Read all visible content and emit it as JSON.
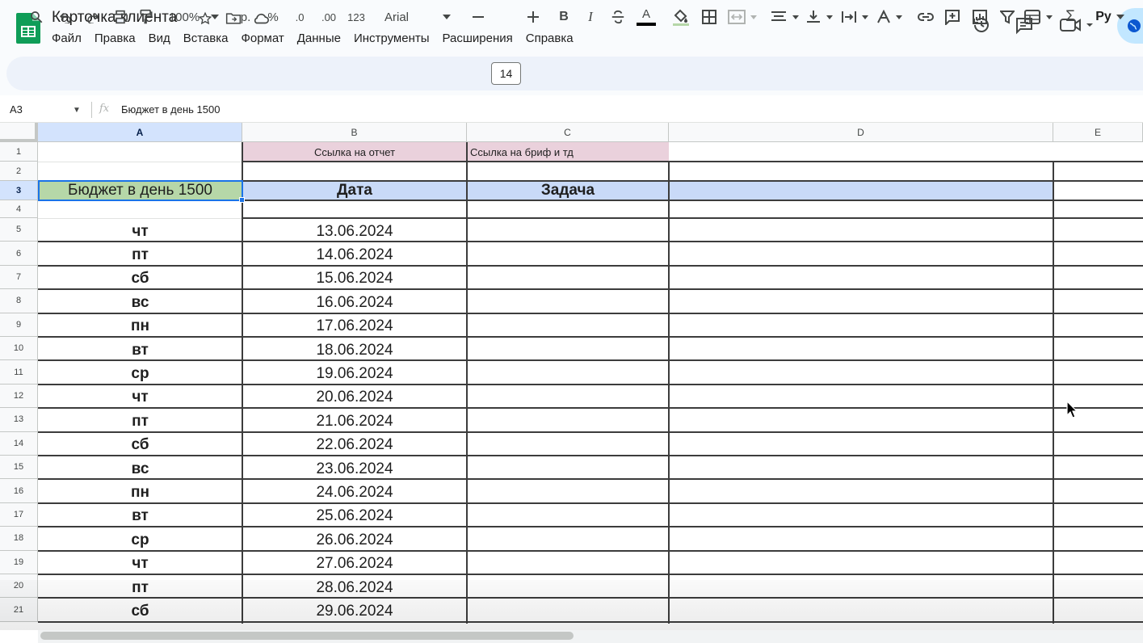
{
  "window": {
    "title": "Карточка клиента"
  },
  "menu": [
    "Файл",
    "Правка",
    "Вид",
    "Вставка",
    "Формат",
    "Данные",
    "Инструменты",
    "Расширения",
    "Справка"
  ],
  "toolbar": {
    "zoom": "100%",
    "currency": "р.",
    "percent": "%",
    "decrease_decimals": ".0",
    "increase_decimals": ".00",
    "number_format": "123",
    "font": "Arial",
    "font_size": "14",
    "input_tools": "Ру"
  },
  "formula_bar": {
    "cell_ref": "A3",
    "fx": "fx",
    "content": "Бюджет в день 1500"
  },
  "columns": [
    "A",
    "B",
    "C",
    "D",
    "E"
  ],
  "row_numbers": [
    "1",
    "2",
    "3",
    "4",
    "5",
    "6",
    "7",
    "8",
    "9",
    "10",
    "11",
    "12",
    "13",
    "14",
    "15",
    "16",
    "17",
    "18",
    "19",
    "20",
    "21"
  ],
  "cells": {
    "B1": "Ссылка на отчет",
    "C1": "Ссылка на бриф и тд",
    "A3": "Бюджет в день 1500",
    "B3": "Дата",
    "C3": "Задача"
  },
  "schedule": [
    {
      "day": "чт",
      "date": "13.06.2024"
    },
    {
      "day": "пт",
      "date": "14.06.2024"
    },
    {
      "day": "сб",
      "date": "15.06.2024"
    },
    {
      "day": "вс",
      "date": "16.06.2024"
    },
    {
      "day": "пн",
      "date": "17.06.2024"
    },
    {
      "day": "вт",
      "date": "18.06.2024"
    },
    {
      "day": "ср",
      "date": "19.06.2024"
    },
    {
      "day": "чт",
      "date": "20.06.2024"
    },
    {
      "day": "пт",
      "date": "21.06.2024"
    },
    {
      "day": "сб",
      "date": "22.06.2024"
    },
    {
      "day": "вс",
      "date": "23.06.2024"
    },
    {
      "day": "пн",
      "date": "24.06.2024"
    },
    {
      "day": "вт",
      "date": "25.06.2024"
    },
    {
      "day": "ср",
      "date": "26.06.2024"
    },
    {
      "day": "чт",
      "date": "27.06.2024"
    },
    {
      "day": "пт",
      "date": "28.06.2024"
    },
    {
      "day": "сб",
      "date": "29.06.2024"
    }
  ],
  "colors": {
    "header_pink": "#ead1dc",
    "budget_green": "#b6d7a8",
    "header_blue": "#c9daf8",
    "selection": "#1a73e8"
  }
}
